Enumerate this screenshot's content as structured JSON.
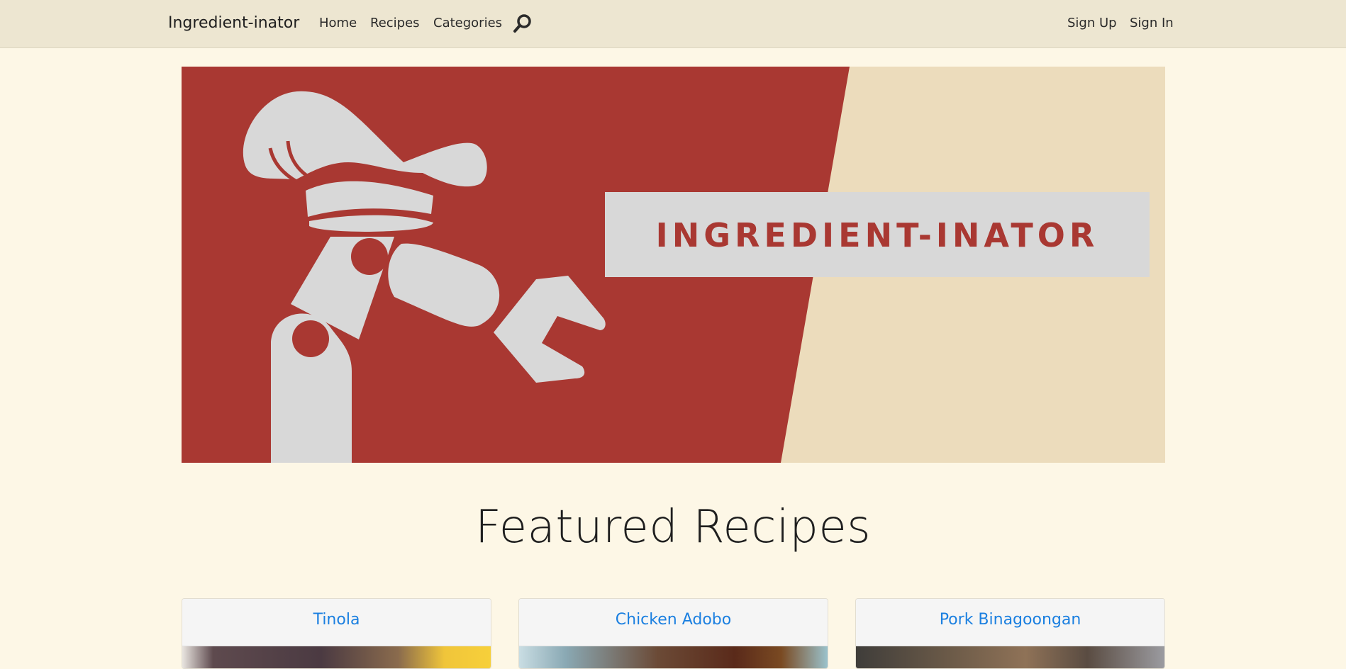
{
  "navbar": {
    "brand": "Ingredient-inator",
    "links": [
      {
        "label": "Home"
      },
      {
        "label": "Recipes"
      },
      {
        "label": "Categories"
      }
    ],
    "search_icon": "search-icon",
    "right_links": [
      {
        "label": "Sign Up"
      },
      {
        "label": "Sign In"
      }
    ]
  },
  "hero": {
    "banner_text": "INGREDIENT-INATOR",
    "colors": {
      "red": "#a93832",
      "beige": "#ecdcbc",
      "light_gray": "#d8d8d8"
    }
  },
  "featured": {
    "title": "Featured Recipes",
    "cards": [
      {
        "title": "Tinola"
      },
      {
        "title": "Chicken Adobo"
      },
      {
        "title": "Pork Binagoongan"
      }
    ]
  },
  "colors": {
    "page_bg": "#fdf7e6",
    "navbar_bg": "#ede6d1",
    "link_blue": "#1a7fe0"
  }
}
